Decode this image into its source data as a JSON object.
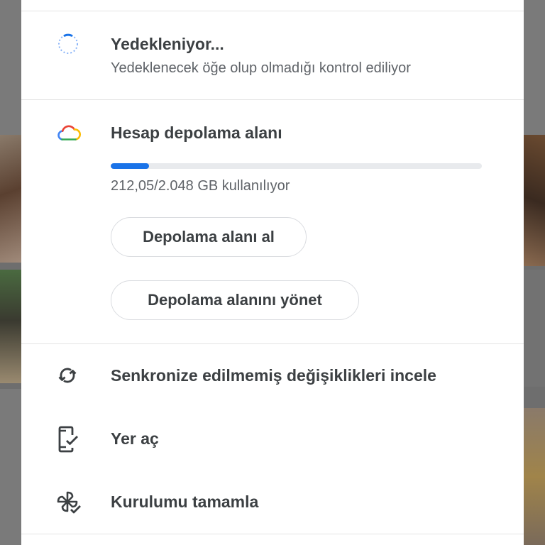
{
  "backup": {
    "title": "Yedekleniyor...",
    "subtitle": "Yedeklenecek öğe olup olmadığı kontrol ediliyor",
    "icon": "progress-spinner-icon"
  },
  "storage": {
    "title": "Hesap depolama alanı",
    "icon": "cloud-icon",
    "usage_text": "212,05/2.048 GB kullanılıyor",
    "used_fraction": 0.1035,
    "bar_color": "#1a73e8",
    "get_storage_label": "Depolama alanı al",
    "manage_storage_label": "Depolama alanını yönet"
  },
  "menu": {
    "items": [
      {
        "label": "Senkronize edilmemiş değişiklikleri incele",
        "icon": "sync-icon"
      },
      {
        "label": "Yer aç",
        "icon": "phone-check-icon"
      },
      {
        "label": "Kurulumu tamamla",
        "icon": "pinwheel-check-icon"
      }
    ]
  }
}
